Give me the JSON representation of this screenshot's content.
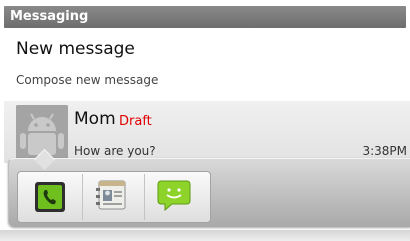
{
  "title_bar": {
    "title": "Messaging"
  },
  "new_message": {
    "title": "New message",
    "subtitle": "Compose new message"
  },
  "conversation": {
    "name": "Mom",
    "draft_label": "Draft",
    "snippet": "How are you?",
    "time": "3:38PM"
  },
  "quick_contact": {
    "actions": [
      {
        "icon": "phone-icon"
      },
      {
        "icon": "contact-card-icon"
      },
      {
        "icon": "sms-icon"
      }
    ]
  },
  "colors": {
    "title_bar": "#7a7a7a",
    "draft": "#e00000",
    "call_green": "#6fc01f",
    "sms_green": "#8ed32a"
  }
}
